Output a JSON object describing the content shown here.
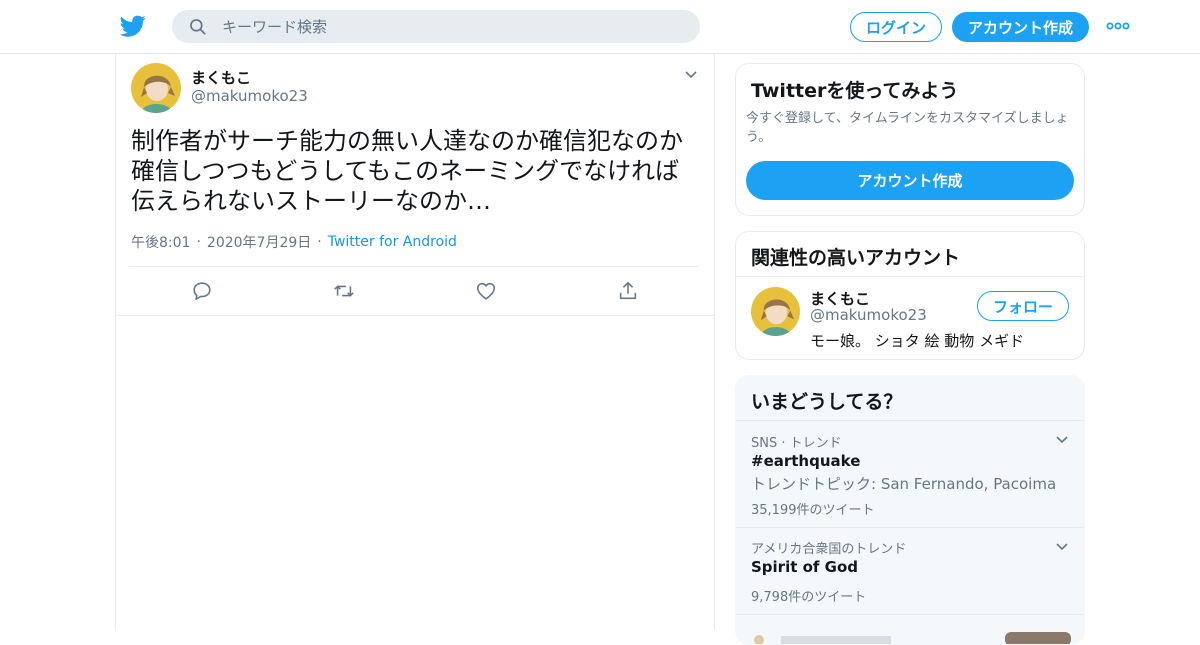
{
  "header": {
    "search_placeholder": "キーワード検索",
    "login_label": "ログイン",
    "signup_label": "アカウント作成",
    "brand_color": "#1da1f2"
  },
  "tweet": {
    "name": "まくもこ",
    "handle": "@makumoko23",
    "text": "制作者がサーチ能力の無い人達なのか確信犯なのか確信しつつもどうしてもこのネーミングでなければ伝えられないストーリーなのか…",
    "time": "午後8:01",
    "date": "2020年7月29日",
    "source": "Twitter for Android",
    "actions": [
      "reply-icon",
      "retweet-icon",
      "like-icon",
      "share-icon"
    ]
  },
  "sidebar": {
    "signup_card": {
      "title": "Twitterを使ってみよう",
      "description": "今すぐ登録して、タイムラインをカスタマイズしましょう。",
      "button_label": "アカウント作成"
    },
    "related": {
      "title": "関連性の高いアカウント",
      "account": {
        "name": "まくもこ",
        "handle": "@makumoko23",
        "bio": "モー娘。 ショタ 絵 動物 メギド",
        "follow_label": "フォロー"
      }
    },
    "trends": {
      "title": "いまどうしてる？",
      "items": [
        {
          "context": "SNS · トレンド",
          "name": "#earthquake",
          "topic": "トレンドトピック: San Fernando, Pacoima",
          "count": "35,199件のツイート"
        },
        {
          "context": "アメリカ合衆国のトレンド",
          "name": "Spirit of God",
          "count": "9,798件のツイート"
        }
      ]
    }
  }
}
